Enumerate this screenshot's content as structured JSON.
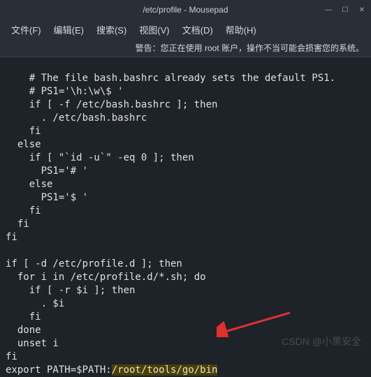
{
  "titlebar": {
    "title": "/etc/profile - Mousepad"
  },
  "menus": {
    "file": "文件(F)",
    "edit": "编辑(E)",
    "search": "搜索(S)",
    "view": "视图(V)",
    "document": "文档(D)",
    "help": "帮助(H)"
  },
  "warning": "警告：您正在使用 root 账户，操作不当可能会损害您的系统。",
  "code": {
    "lines": [
      "    # The file bash.bashrc already sets the default PS1.",
      "    # PS1='\\h:\\w\\$ '",
      "    if [ -f /etc/bash.bashrc ]; then",
      "      . /etc/bash.bashrc",
      "    fi",
      "  else",
      "    if [ \"`id -u`\" -eq 0 ]; then",
      "      PS1='# '",
      "    else",
      "      PS1='$ '",
      "    fi",
      "  fi",
      "fi",
      "",
      "if [ -d /etc/profile.d ]; then",
      "  for i in /etc/profile.d/*.sh; do",
      "    if [ -r $i ]; then",
      "      . $i",
      "    fi",
      "  done",
      "  unset i",
      "fi"
    ],
    "highlight_prefix": "export PATH=$PATH:",
    "highlight_text": "/root/tools/go/bin"
  },
  "watermark": "CSDN @小黑安全"
}
